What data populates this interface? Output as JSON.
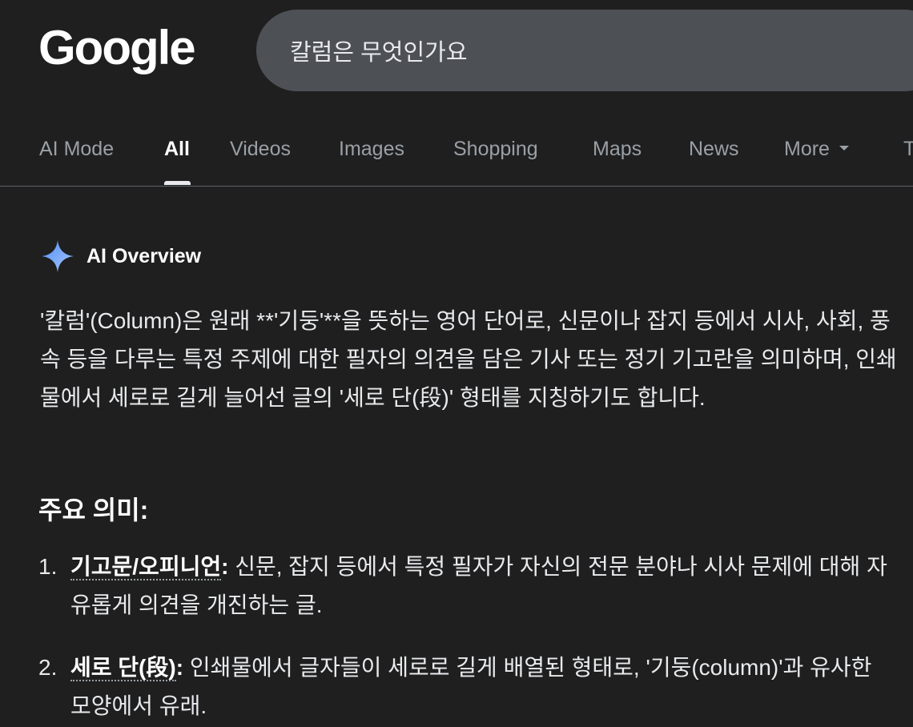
{
  "logo": {
    "text": "Google"
  },
  "search": {
    "query": "칼럼은 무엇인가요"
  },
  "tabs": [
    {
      "label": "AI Mode"
    },
    {
      "label": "All"
    },
    {
      "label": "Videos"
    },
    {
      "label": "Images"
    },
    {
      "label": "Shopping"
    },
    {
      "label": "Maps"
    },
    {
      "label": "News"
    },
    {
      "label": "More"
    },
    {
      "label": "T"
    }
  ],
  "ai_overview": {
    "title": "AI Overview",
    "intro": "'칼럼'(Column)은 원래 **'기둥'**을 뜻하는 영어 단어로, 신문이나 잡지 등에서 시사, 사회, 풍속 등을 다루는 특정 주제에 대한 필자의 의견을 담은 기사 또는 정기 기고란을 의미하며, 인쇄물에서 세로로 길게 늘어선 글의 '세로 단(段)' 형태를 지칭하기도 합니다.",
    "section_title": "주요 의미:",
    "items": [
      {
        "number": "1.",
        "term": "기고문/오피니언",
        "colon": ":",
        "text": " 신문, 잡지 등에서 특정 필자가 자신의 전문 분야나 시사 문제에 대해 자유롭게 의견을 개진하는 글."
      },
      {
        "number": "2.",
        "term": "세로 단(段)",
        "colon": ":",
        "text": " 인쇄물에서 글자들이 세로로 길게 배열된 형태로, '기둥(column)'과 유사한 모양에서 유래."
      }
    ]
  },
  "colors": {
    "background": "#1f1f1f",
    "search_bar": "#4d5156",
    "tab_inactive": "#9aa0a6",
    "spark_blue": "#8ab4f8"
  }
}
